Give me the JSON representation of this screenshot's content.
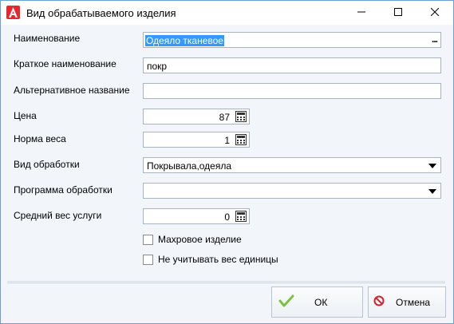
{
  "window": {
    "title": "Вид обрабатываемого изделия",
    "accent_color": "#e8262e"
  },
  "form": {
    "name_label": "Наименование",
    "name_value": "Одеяло тканевое",
    "name_lookup": "...",
    "short_name_label": "Краткое наименование",
    "short_name_value": "покр",
    "alt_name_label": "Альтернативное название",
    "alt_name_value": "",
    "price_label": "Цена",
    "price_value": "87",
    "weight_norm_label": "Норма веса",
    "weight_norm_value": "1",
    "processing_type_label": "Вид обработки",
    "processing_type_value": "Покрывала,одеяла",
    "processing_program_label": "Программа обработки",
    "processing_program_value": "",
    "avg_weight_label": "Средний вес услуги",
    "avg_weight_value": "0",
    "terry_label": "Махровое изделие",
    "terry_checked": false,
    "ignore_weight_label": "Не учитывать вес единицы",
    "ignore_weight_checked": false
  },
  "buttons": {
    "ok_label": "ОК",
    "cancel_label": "Отмена"
  },
  "icons": {
    "app": "app-logo-icon",
    "minimize": "minimize-icon",
    "maximize": "maximize-icon",
    "close": "close-icon",
    "calculator": "calculator-icon",
    "dropdown": "chevron-down-icon",
    "ok": "checkmark-icon",
    "cancel": "prohibited-icon"
  }
}
